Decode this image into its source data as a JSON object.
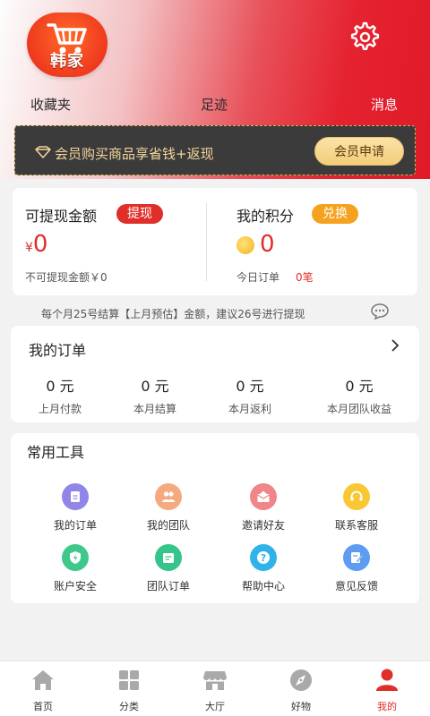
{
  "header": {
    "logo_text": "韩家",
    "links": {
      "favorites": "收藏夹",
      "footprints": "足迹",
      "messages": "消息"
    }
  },
  "vip": {
    "text": "会员购买商品享省钱+返现",
    "button": "会员申请"
  },
  "balance": {
    "withdrawable_label": "可提现金额",
    "withdraw_button": "提现",
    "currency": "¥",
    "withdrawable_amount": "0",
    "non_withdrawable_text": "不可提现金额￥0",
    "points_label": "我的积分",
    "exchange_button": "兑换",
    "points_amount": "0",
    "today_orders_label": "今日订单",
    "today_orders_value": "0笔"
  },
  "notice": "每个月25号结算【上月预估】金额，建议26号进行提现",
  "orders": {
    "title": "我的订单",
    "stats": [
      {
        "value": "0 元",
        "label": "上月付款"
      },
      {
        "value": "0 元",
        "label": "本月结算"
      },
      {
        "value": "0 元",
        "label": "本月返利"
      },
      {
        "value": "0 元",
        "label": "本月团队收益"
      }
    ]
  },
  "tools": {
    "title": "常用工具",
    "items": [
      {
        "label": "我的订单",
        "icon": "order-icon",
        "color": "#8f86e8"
      },
      {
        "label": "我的团队",
        "icon": "team-icon",
        "color": "#f5a97e"
      },
      {
        "label": "邀请好友",
        "icon": "invite-icon",
        "color": "#f0858a"
      },
      {
        "label": "联系客服",
        "icon": "service-icon",
        "color": "#f9c733"
      },
      {
        "label": "账户安全",
        "icon": "shield-icon",
        "color": "#3ec98a"
      },
      {
        "label": "团队订单",
        "icon": "team-order-icon",
        "color": "#35c48a"
      },
      {
        "label": "帮助中心",
        "icon": "help-icon",
        "color": "#2fb3e8"
      },
      {
        "label": "意见反馈",
        "icon": "feedback-icon",
        "color": "#5d9cf0"
      }
    ]
  },
  "tabbar": {
    "items": [
      {
        "label": "首页",
        "icon": "home-icon"
      },
      {
        "label": "分类",
        "icon": "grid-icon"
      },
      {
        "label": "大厅",
        "icon": "store-icon"
      },
      {
        "label": "好物",
        "icon": "compass-icon"
      },
      {
        "label": "我的",
        "icon": "user-icon",
        "active": true
      }
    ]
  },
  "colors": {
    "accent": "#e02e2a",
    "points": "#f5a31e",
    "vip_gold": "#f4d69a"
  }
}
